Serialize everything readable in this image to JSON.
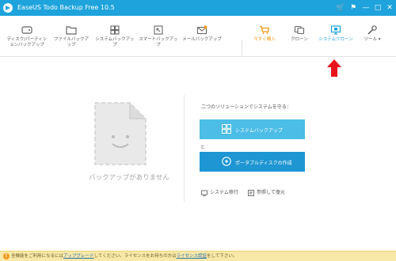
{
  "window": {
    "title": "EaseUS Todo Backup Free 10.5",
    "controls": [
      "🛒",
      "⚑",
      "—",
      "□",
      "✕"
    ]
  },
  "toolbar": {
    "items": [
      {
        "label": "ディスク/パーティションバックアップ",
        "icon": "disk-icon"
      },
      {
        "label": "ファイルバックアップ",
        "icon": "folder-icon"
      },
      {
        "label": "システムバックアップ",
        "icon": "windows-icon"
      },
      {
        "label": "スマートバックアップ",
        "icon": "smart-icon"
      },
      {
        "label": "メールバックアップ",
        "icon": "mail-icon"
      }
    ],
    "right_items": [
      {
        "label": "今すぐ購入",
        "icon": "cart-icon",
        "color": "#f29a1d"
      },
      {
        "label": "クローン",
        "icon": "clone-icon"
      },
      {
        "label": "システムクローン",
        "icon": "system-clone-icon",
        "color": "#1ea3dc"
      },
      {
        "label": "ツール ▾",
        "icon": "wrench-icon"
      }
    ]
  },
  "main": {
    "empty_text": "バックアップがありません",
    "hint": "二つのソリューションでシステムを守る：",
    "system_backup_label": "システムバックアップ",
    "or_text": "と",
    "portable_disk_label": "ポータブルディスクの作成",
    "system_transfer_label": "システム移行",
    "browse_restore_label": "参照して復元"
  },
  "bottom": {
    "notice_part1": "全機能をご利用になるには",
    "upgrade_link": "アップグレード",
    "notice_part2": "してください。ライセンスをお持ちの方は",
    "activate_link": "ライセンス認証",
    "notice_part3": "をして下さい。"
  },
  "colors": {
    "accent": "#1ea3dc",
    "buy": "#f29a1d",
    "system_backup_button": "#4bbde6",
    "portable_button": "#1e96d3",
    "notice_bg": "#f8e9a8",
    "arrow": "#e8141b"
  }
}
